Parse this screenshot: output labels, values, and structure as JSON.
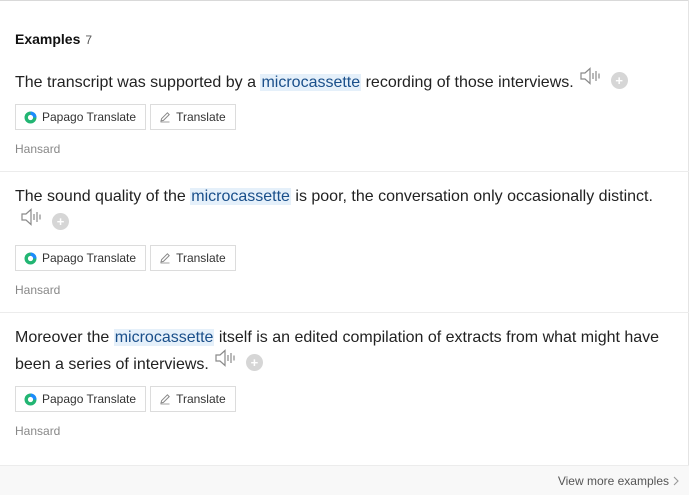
{
  "section": {
    "title": "Examples",
    "count": "7"
  },
  "examples": [
    {
      "before": "The transcript was supported by a ",
      "keyword": "microcassette",
      "after": " recording of those interviews.",
      "papago_label": "Papago Translate",
      "translate_label": "Translate",
      "source": "Hansard"
    },
    {
      "before": "The sound quality of the ",
      "keyword": "microcassette",
      "after": " is poor, the conversation only occasionally distinct.",
      "papago_label": "Papago Translate",
      "translate_label": "Translate",
      "source": "Hansard"
    },
    {
      "before": "Moreover the ",
      "keyword": "microcassette",
      "after": " itself is an edited compilation of extracts from what might have been a series of interviews.",
      "papago_label": "Papago Translate",
      "translate_label": "Translate",
      "source": "Hansard"
    }
  ],
  "footer": {
    "view_more_label": "View more examples"
  },
  "icons": {
    "speaker": "speaker-icon",
    "add": "plus-circle-icon",
    "papago": "papago-logo-icon",
    "translate": "pencil-icon",
    "chevron": "chevron-right-icon"
  },
  "colors": {
    "highlight_bg": "#e5f0fa",
    "papago_green": "#22b573",
    "papago_blue": "#1c8bff"
  }
}
